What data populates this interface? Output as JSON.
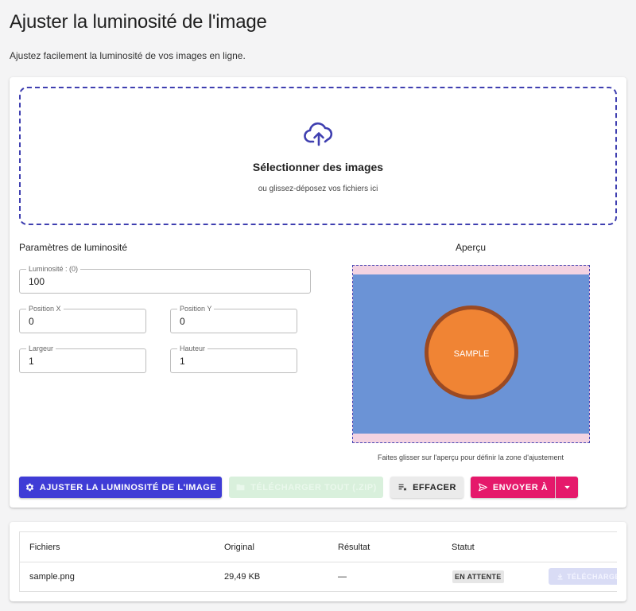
{
  "page": {
    "title": "Ajuster la luminosité de l'image",
    "subtitle": "Ajustez facilement la luminosité de vos images en ligne."
  },
  "dropzone": {
    "icon": "cloud-upload-icon",
    "title": "Sélectionner des images",
    "subtitle": "ou glissez-déposez vos fichiers ici"
  },
  "params": {
    "title": "Paramètres de luminosité",
    "brightness": {
      "label": "Luminosité : (0)",
      "value": "100"
    },
    "position_x": {
      "label": "Position X",
      "value": "0"
    },
    "position_y": {
      "label": "Position Y",
      "value": "0"
    },
    "width": {
      "label": "Largeur",
      "value": "1"
    },
    "height": {
      "label": "Hauteur",
      "value": "1"
    }
  },
  "preview": {
    "title": "Aperçu",
    "sample_text": "SAMPLE",
    "hint": "Faites glisser sur l'aperçu pour définir la zone d'ajustement"
  },
  "actions": {
    "adjust_label": "AJUSTER LA LUMINOSITÉ DE L'IMAGE",
    "download_all_label": "TÉLÉCHARGER TOUT (.ZIP)",
    "clear_label": "EFFACER",
    "send_label": "ENVOYER À"
  },
  "table": {
    "headers": {
      "files": "Fichiers",
      "original": "Original",
      "result": "Résultat",
      "status": "Statut"
    },
    "rows": [
      {
        "file": "sample.png",
        "original": "29,49 KB",
        "result": "—",
        "status": "EN ATTENTE",
        "download_label": "TÉLÉCHARGER"
      }
    ]
  },
  "colors": {
    "primary": "#3f3cd6",
    "accent": "#e5196b",
    "success_disabled": "#d9f0dc"
  }
}
